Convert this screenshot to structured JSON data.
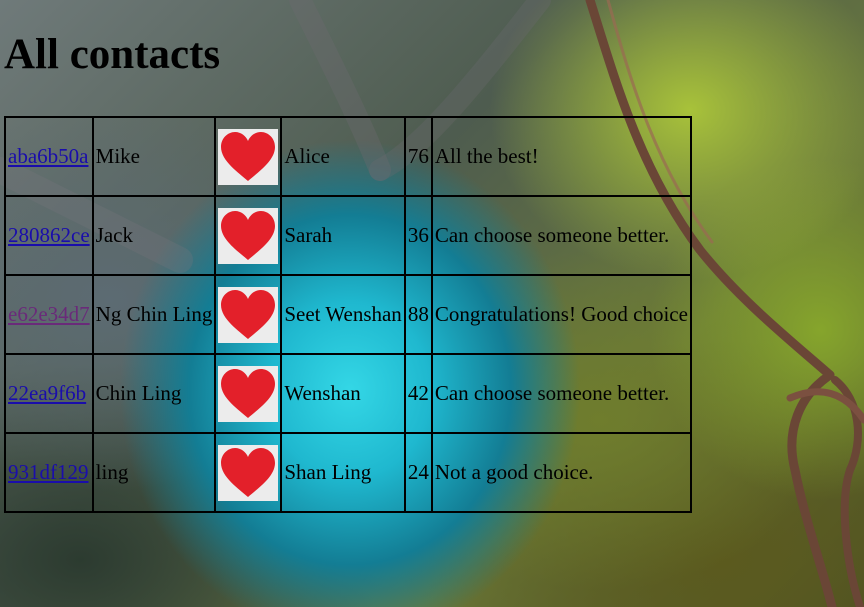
{
  "page": {
    "title": "All contacts"
  },
  "contacts": [
    {
      "id": "aba6b50a",
      "name": "Mike",
      "partner": "Alice",
      "score": "76",
      "comment": "All the best!",
      "visited": false
    },
    {
      "id": "280862ce",
      "name": "Jack",
      "partner": "Sarah",
      "score": "36",
      "comment": "Can choose someone better.",
      "visited": false
    },
    {
      "id": "e62e34d7",
      "name": "Ng Chin Ling",
      "partner": "Seet Wenshan",
      "score": "88",
      "comment": "Congratulations! Good choice",
      "visited": true
    },
    {
      "id": "22ea9f6b",
      "name": "Chin Ling",
      "partner": "Wenshan",
      "score": "42",
      "comment": "Can choose someone better.",
      "visited": false
    },
    {
      "id": "931df129",
      "name": "ling",
      "partner": "Shan Ling",
      "score": "24",
      "comment": "Not a good choice.",
      "visited": false
    }
  ],
  "icons": {
    "row_icon": "heart-icon",
    "heart_color": "#e3202a",
    "heart_bg": "#ececec"
  },
  "colors": {
    "link": "#1a0dab",
    "visited_link": "#6a2a7a"
  }
}
